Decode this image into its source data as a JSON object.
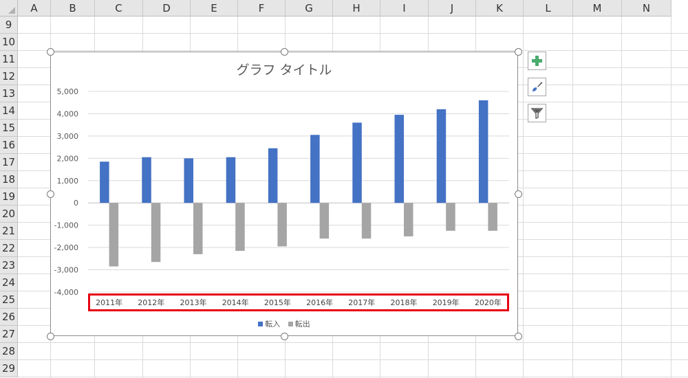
{
  "sheet": {
    "columns": [
      "A",
      "B",
      "C",
      "D",
      "E",
      "F",
      "G",
      "H",
      "I",
      "J",
      "K",
      "L",
      "M",
      "N"
    ],
    "rows": [
      "9",
      "10",
      "11",
      "12",
      "13",
      "14",
      "15",
      "16",
      "17",
      "18",
      "19",
      "20",
      "21",
      "22",
      "23",
      "24",
      "25",
      "26",
      "27",
      "28",
      "29"
    ]
  },
  "chart_data": {
    "type": "bar",
    "title": "グラフ タイトル",
    "categories": [
      "2011年",
      "2012年",
      "2013年",
      "2014年",
      "2015年",
      "2016年",
      "2017年",
      "2018年",
      "2019年",
      "2020年"
    ],
    "series": [
      {
        "name": "転入",
        "color": "#4472c4",
        "values": [
          1850,
          2050,
          2000,
          2050,
          2450,
          3050,
          3600,
          3950,
          4200,
          4600
        ]
      },
      {
        "name": "転出",
        "color": "#a5a5a5",
        "values": [
          -2850,
          -2650,
          -2300,
          -2150,
          -1950,
          -1600,
          -1600,
          -1500,
          -1250,
          -1250
        ]
      }
    ],
    "ylim": [
      -4000,
      5000
    ],
    "yticks": [
      5000,
      4000,
      3000,
      2000,
      1000,
      0,
      -1000,
      -2000,
      -3000,
      -4000
    ],
    "ytick_labels": [
      "5,000",
      "4,000",
      "3,000",
      "2,000",
      "1,000",
      "0",
      "-1,000",
      "-2,000",
      "-3,000",
      "-4,000"
    ],
    "grid": true,
    "legend": "bottom"
  },
  "side_buttons": {
    "elements": "plus-icon",
    "styles": "brush-icon",
    "filters": "funnel-icon"
  },
  "colors": {
    "highlight": "#e60012",
    "add_icon": "#4aaa6e"
  }
}
